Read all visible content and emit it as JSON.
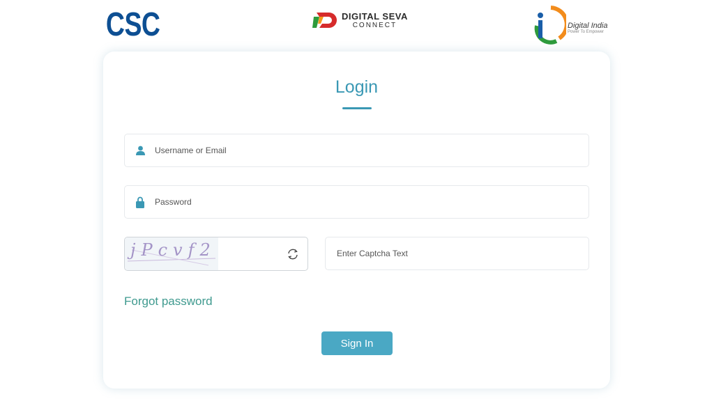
{
  "header": {
    "csc_logo_text": [
      "C",
      "S",
      "C"
    ],
    "dsc_line1": "DIGITAL SEVA",
    "dsc_line2": "CONNECT",
    "di_line1": "Digital India",
    "di_line2": "Power To Empower"
  },
  "login": {
    "title": "Login",
    "username_placeholder": "Username or Email",
    "password_placeholder": "Password",
    "captcha_text": "jPcvf2",
    "captcha_placeholder": "Enter Captcha Text",
    "forgot_label": "Forgot password",
    "signin_label": "Sign In"
  },
  "colors": {
    "accent": "#3a98b4",
    "button": "#4aa8c4",
    "link": "#3f9a8f",
    "csc_blue": "#0d4f93"
  },
  "icons": {
    "username": "user-icon",
    "password": "lock-icon",
    "refresh": "refresh-icon"
  }
}
